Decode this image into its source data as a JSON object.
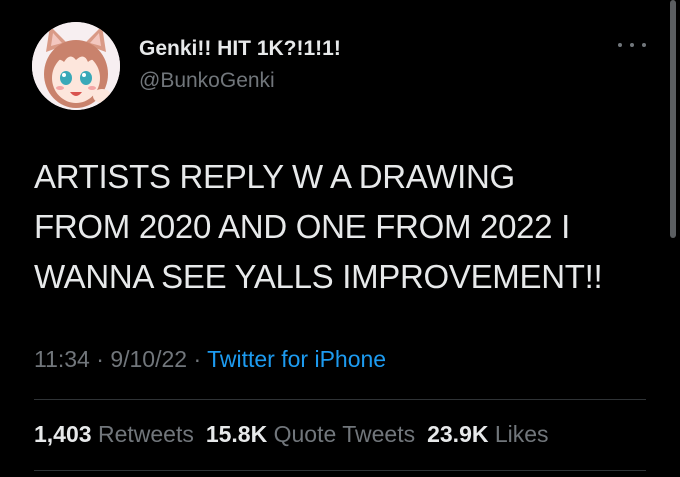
{
  "user": {
    "display_name": "Genki!! HIT 1K?!1!1!",
    "handle": "@BunkoGenki"
  },
  "tweet": {
    "lines": [
      "ARTISTS REPLY W A DRAWING",
      "FROM 2020 AND ONE FROM 2022 I",
      "WANNA SEE YALLS IMPROVEMENT!!"
    ],
    "time": "11:34",
    "date": "9/10/22",
    "separator": "·",
    "source": "Twitter for iPhone"
  },
  "stats": {
    "retweets_count": "1,403",
    "retweets_label": "Retweets",
    "quotes_count": "15.8K",
    "quotes_label": "Quote Tweets",
    "likes_count": "23.9K",
    "likes_label": "Likes"
  },
  "icons": {
    "more": "more-options-icon",
    "avatar": "anime-avatar"
  },
  "colors": {
    "background": "#000000",
    "primary_text": "#e7e9ea",
    "secondary_text": "#71767b",
    "link": "#1d9bf0",
    "divider": "#2f3336"
  }
}
